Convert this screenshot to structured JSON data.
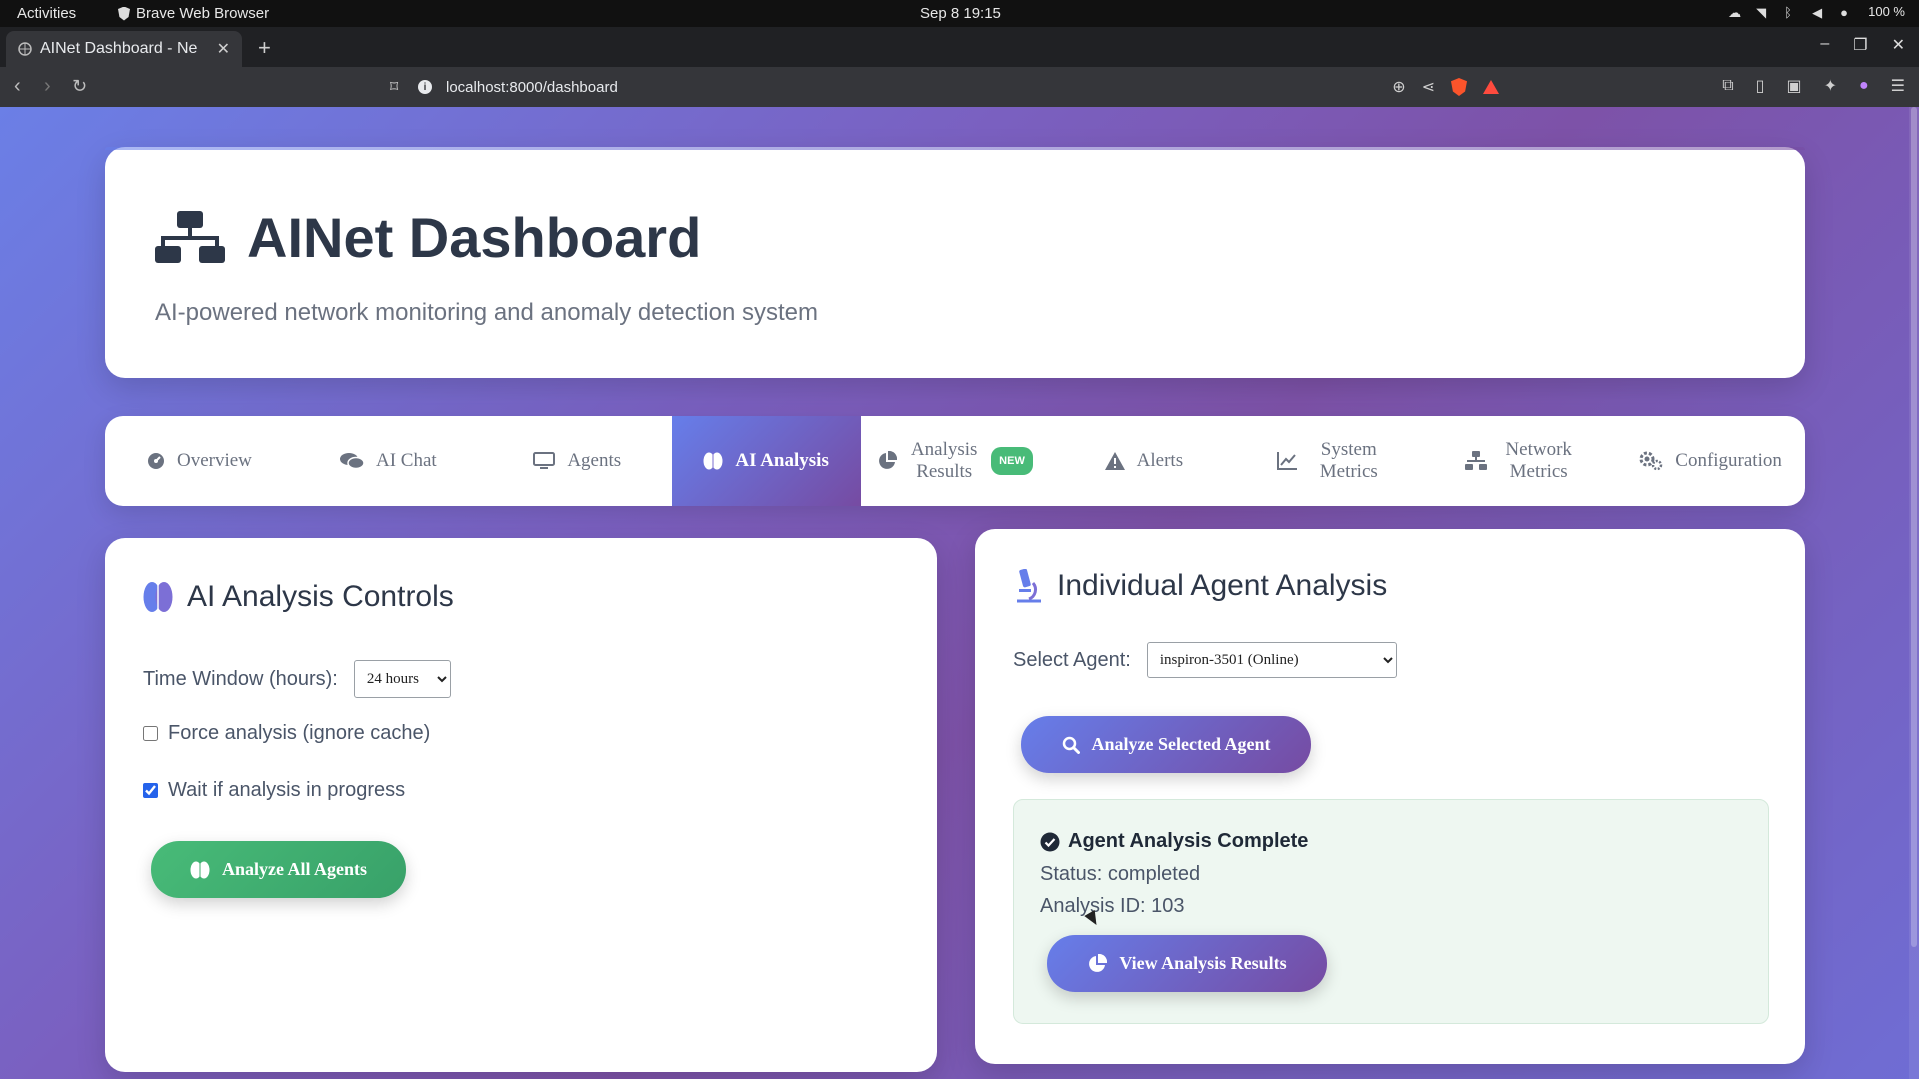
{
  "os": {
    "activities": "Activities",
    "app_name": "Brave Web Browser",
    "clock": "Sep 8  19:15",
    "battery": "100 %"
  },
  "browser": {
    "tab_title": "AINet Dashboard - Ne",
    "url": "localhost:8000/dashboard"
  },
  "header": {
    "title": "AINet Dashboard",
    "subtitle": "AI-powered network monitoring and anomaly detection system"
  },
  "nav": {
    "tabs": [
      {
        "label": "Overview"
      },
      {
        "label": "AI Chat"
      },
      {
        "label": "Agents"
      },
      {
        "label": "AI Analysis",
        "active": true
      },
      {
        "label": "Analysis Results",
        "badge": "NEW"
      },
      {
        "label": "Alerts"
      },
      {
        "label": "System Metrics"
      },
      {
        "label": "Network Metrics"
      },
      {
        "label": "Configuration"
      }
    ]
  },
  "controls": {
    "title": "AI Analysis Controls",
    "time_window_label": "Time Window (hours):",
    "time_window_value": "24 hours",
    "force_label": "Force analysis (ignore cache)",
    "force_checked": false,
    "wait_label": "Wait if analysis in progress",
    "wait_checked": true,
    "analyze_all_label": "Analyze All Agents"
  },
  "agent_analysis": {
    "title": "Individual Agent Analysis",
    "select_label": "Select Agent:",
    "selected_agent": "inspiron-3501 (Online)",
    "analyze_button": "Analyze Selected Agent",
    "result": {
      "title": "Agent Analysis Complete",
      "status_line": "Status: completed",
      "analysis_id_line": "Analysis ID: 103",
      "view_button": "View Analysis Results"
    }
  },
  "colors": {
    "accent_start": "#667eea",
    "accent_end": "#764ba2",
    "success": "#48bb78"
  }
}
